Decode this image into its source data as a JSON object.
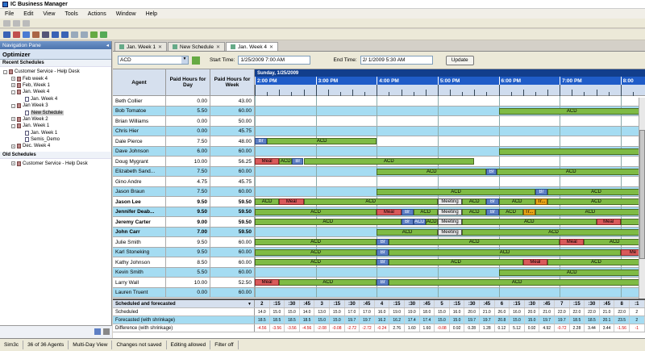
{
  "app": {
    "title": "IC Business Manager"
  },
  "menu": [
    "File",
    "Edit",
    "View",
    "Tools",
    "Actions",
    "Window",
    "Help"
  ],
  "nav": {
    "pane_title": "Navigation Pane",
    "optimizer": "Optimizer",
    "recent_header": "Recent Schedules",
    "recent": [
      {
        "label": "Customer Service - Help Desk",
        "indent": 0,
        "icon": "folder-icon",
        "toggle": "-"
      },
      {
        "label": "Feb week 4",
        "indent": 1,
        "icon": "schedule-icon",
        "toggle": "+"
      },
      {
        "label": "Feb, Week 1",
        "indent": 1,
        "icon": "schedule-icon",
        "toggle": "+"
      },
      {
        "label": "Jan. Week 4",
        "indent": 1,
        "icon": "schedule-icon",
        "toggle": "-"
      },
      {
        "label": "Jan. Week 4",
        "indent": 2,
        "icon": "sheet-icon",
        "toggle": ""
      },
      {
        "label": "Jan Week 3",
        "indent": 1,
        "icon": "schedule-icon",
        "toggle": "-"
      },
      {
        "label": "New Schedule",
        "indent": 2,
        "icon": "sheet-icon",
        "toggle": "",
        "selected": true
      },
      {
        "label": "Jan Week 2",
        "indent": 1,
        "icon": "schedule-icon",
        "toggle": "+"
      },
      {
        "label": "Jan. Week 1",
        "indent": 1,
        "icon": "schedule-icon",
        "toggle": "-"
      },
      {
        "label": "Jan. Week 1",
        "indent": 2,
        "icon": "sheet-icon",
        "toggle": ""
      },
      {
        "label": "Semis_Demo",
        "indent": 2,
        "icon": "sheet-icon",
        "toggle": ""
      },
      {
        "label": "Dec. Week 4",
        "indent": 1,
        "icon": "schedule-icon",
        "toggle": "+"
      }
    ],
    "old_header": "Old Schedules",
    "old": [
      {
        "label": "Customer Service - Help Desk",
        "indent": 1,
        "icon": "folder-icon",
        "toggle": "+"
      }
    ]
  },
  "tabs": [
    {
      "label": "Jan. Week 1",
      "active": false
    },
    {
      "label": "New Schedule",
      "active": false
    },
    {
      "label": "Jan. Week 4",
      "active": true
    }
  ],
  "filters": {
    "queue": "ACD",
    "start_label": "Start Time:",
    "start_value": "1/25/2009  7:00 AM",
    "end_label": "End Time:",
    "end_value": "2/  1/2009  5:30 AM",
    "update": "Update"
  },
  "columns": {
    "agent": "Agent",
    "paid_day": "Paid Hours for Day",
    "paid_week": "Paid Hours for Week"
  },
  "timeline": {
    "date": "Sunday, 1/25/2009",
    "hours": [
      "2:00 PM",
      "3:00 PM",
      "4:00 PM",
      "5:00 PM",
      "6:00 PM",
      "7:00 PM",
      "8:00"
    ]
  },
  "agents": [
    {
      "name": "Beth Collier",
      "day": "0.00",
      "week": "43.00",
      "bold": false,
      "hl": false,
      "segs": []
    },
    {
      "name": "Bob Tomatoe",
      "day": "5.50",
      "week": "60.00",
      "bold": false,
      "hl": true,
      "segs": [
        [
          300,
          480,
          "ACD",
          "ACD"
        ]
      ]
    },
    {
      "name": "Brian Williams",
      "day": "0.00",
      "week": "50.00",
      "bold": false,
      "hl": false,
      "segs": []
    },
    {
      "name": "Chris Hier",
      "day": "0.00",
      "week": "45.75",
      "bold": false,
      "hl": true,
      "segs": []
    },
    {
      "name": "Dale Pierce",
      "day": "7.50",
      "week": "48.00",
      "bold": false,
      "hl": false,
      "segs": [
        [
          0,
          15,
          "Br",
          "Br"
        ],
        [
          15,
          150,
          "ACD",
          "ACD"
        ]
      ]
    },
    {
      "name": "Dave Johnson",
      "day": "6.00",
      "week": "60.00",
      "bold": false,
      "hl": true,
      "segs": [
        [
          300,
          480,
          "ACD",
          ""
        ]
      ]
    },
    {
      "name": "Doug Mygrant",
      "day": "10.00",
      "week": "56.25",
      "bold": false,
      "hl": false,
      "segs": [
        [
          0,
          30,
          "Meal",
          "Meal"
        ],
        [
          30,
          46,
          "ACD",
          "ACD"
        ],
        [
          46,
          60,
          "Br",
          "Br"
        ],
        [
          60,
          270,
          "ACD",
          "ACD"
        ]
      ]
    },
    {
      "name": "Elizabeth Sand...",
      "day": "7.50",
      "week": "60.00",
      "bold": false,
      "hl": true,
      "segs": [
        [
          150,
          285,
          "ACD",
          "ACD"
        ],
        [
          285,
          298,
          "Br",
          "Br"
        ],
        [
          298,
          480,
          "ACD",
          "ACD"
        ]
      ]
    },
    {
      "name": "Gino Andre",
      "day": "4.75",
      "week": "45.75",
      "bold": false,
      "hl": false,
      "segs": []
    },
    {
      "name": "Jason Braun",
      "day": "7.50",
      "week": "60.00",
      "bold": false,
      "hl": true,
      "segs": [
        [
          150,
          345,
          "ACD",
          "ACD"
        ],
        [
          345,
          360,
          "Br",
          "Br"
        ],
        [
          360,
          480,
          "ACD",
          "ACD"
        ]
      ]
    },
    {
      "name": "Jason Lee",
      "day": "9.50",
      "week": "59.50",
      "bold": true,
      "hl": false,
      "segs": [
        [
          0,
          30,
          "ACD",
          "ACD"
        ],
        [
          30,
          60,
          "Meal",
          "Meal"
        ],
        [
          60,
          225,
          "ACD",
          "ACD"
        ],
        [
          225,
          255,
          "Meeting",
          "Meeting"
        ],
        [
          255,
          285,
          "ACD",
          "ACD"
        ],
        [
          285,
          300,
          "Br",
          "Br"
        ],
        [
          300,
          345,
          "ACD",
          "ACD"
        ],
        [
          345,
          360,
          "Tr",
          "Tr..."
        ],
        [
          360,
          480,
          "ACD",
          "ACD"
        ]
      ]
    },
    {
      "name": "Jennifer Deab...",
      "day": "9.50",
      "week": "59.50",
      "bold": true,
      "hl": true,
      "segs": [
        [
          0,
          150,
          "ACD",
          "ACD"
        ],
        [
          150,
          180,
          "Meal",
          "Meal"
        ],
        [
          180,
          195,
          "Br",
          "Br"
        ],
        [
          195,
          225,
          "ACD",
          "ACD"
        ],
        [
          225,
          255,
          "Meeting",
          "Meeting"
        ],
        [
          255,
          285,
          "ACD",
          "ACD"
        ],
        [
          285,
          300,
          "Br",
          "Br"
        ],
        [
          300,
          330,
          "ACD",
          "ACD"
        ],
        [
          330,
          345,
          "Tr",
          "Tr..."
        ],
        [
          345,
          480,
          "ACD",
          "ACD"
        ]
      ]
    },
    {
      "name": "Jeremy Carter",
      "day": "9.00",
      "week": "59.50",
      "bold": true,
      "hl": false,
      "segs": [
        [
          0,
          180,
          "ACD",
          "ACD"
        ],
        [
          180,
          195,
          "Br",
          "Br"
        ],
        [
          195,
          210,
          "Br",
          "ACD"
        ],
        [
          210,
          225,
          "ACD",
          "ACD"
        ],
        [
          225,
          255,
          "Meeting",
          "Meeting"
        ],
        [
          255,
          420,
          "ACD",
          "ACD"
        ],
        [
          420,
          450,
          "Meal",
          "Meal"
        ],
        [
          450,
          480,
          "ACD",
          ""
        ]
      ]
    },
    {
      "name": "John Carr",
      "day": "7.00",
      "week": "59.50",
      "bold": true,
      "hl": true,
      "segs": [
        [
          150,
          225,
          "ACD",
          "ACD"
        ],
        [
          225,
          255,
          "Meeting",
          "Meeting"
        ],
        [
          255,
          480,
          "ACD",
          "ACD"
        ]
      ]
    },
    {
      "name": "Julie Smith",
      "day": "9.50",
      "week": "60.00",
      "bold": false,
      "hl": false,
      "segs": [
        [
          0,
          150,
          "ACD",
          "ACD"
        ],
        [
          150,
          165,
          "Br",
          "Br"
        ],
        [
          165,
          375,
          "ACD",
          "ACD"
        ],
        [
          375,
          405,
          "Meal",
          "Meal"
        ],
        [
          405,
          480,
          "ACD",
          "ACD"
        ]
      ]
    },
    {
      "name": "Karl Stoneking",
      "day": "9.50",
      "week": "60.00",
      "bold": false,
      "hl": true,
      "segs": [
        [
          0,
          150,
          "ACD",
          "ACD"
        ],
        [
          150,
          165,
          "Br",
          "Br"
        ],
        [
          165,
          450,
          "ACD",
          "ACD"
        ],
        [
          450,
          480,
          "Meal",
          "Me"
        ]
      ]
    },
    {
      "name": "Kathy Johnson",
      "day": "8.50",
      "week": "60.00",
      "bold": false,
      "hl": false,
      "segs": [
        [
          0,
          150,
          "ACD",
          "ACD"
        ],
        [
          150,
          165,
          "Br",
          "Br"
        ],
        [
          165,
          330,
          "ACD",
          "ACD"
        ],
        [
          330,
          360,
          "Meal",
          "Meal"
        ],
        [
          360,
          480,
          "ACD",
          "ACD"
        ]
      ]
    },
    {
      "name": "Kevin Smith",
      "day": "5.50",
      "week": "60.00",
      "bold": false,
      "hl": true,
      "segs": [
        [
          300,
          480,
          "ACD",
          "ACD"
        ]
      ]
    },
    {
      "name": "Larry Wall",
      "day": "10.00",
      "week": "52.50",
      "bold": false,
      "hl": false,
      "segs": [
        [
          0,
          30,
          "Meal",
          "Meal"
        ],
        [
          30,
          150,
          "ACD",
          "ACD"
        ],
        [
          150,
          165,
          "Br",
          "Br"
        ],
        [
          165,
          480,
          "ACD",
          "ACD"
        ]
      ]
    },
    {
      "name": "Lauren Truent",
      "day": "0.00",
      "week": "60.00",
      "bold": false,
      "hl": true,
      "segs": []
    }
  ],
  "summary": {
    "dropdown": "Scheduled and forecasted",
    "header": [
      "2",
      ":15",
      ":30",
      ":45",
      "3",
      ":15",
      ":30",
      ":45",
      "4",
      ":15",
      ":30",
      ":45",
      "5",
      ":15",
      ":30",
      ":45",
      "6",
      ":15",
      ":30",
      ":45",
      "7",
      ":15",
      ":30",
      ":45",
      "8",
      ":1"
    ],
    "rows": [
      {
        "label": "Scheduled",
        "values": [
          "14.0",
          "15.0",
          "15.0",
          "14.0",
          "13.0",
          "15.0",
          "17.0",
          "17.0",
          "16.0",
          "19.0",
          "19.0",
          "18.0",
          "15.0",
          "16.0",
          "20.0",
          "21.0",
          "26.0",
          "16.0",
          "20.0",
          "21.0",
          "22.0",
          "22.0",
          "22.0",
          "21.0",
          "22.0",
          "2"
        ],
        "neg": []
      },
      {
        "label": "Forecasted (with shrinkage)",
        "values": [
          "18.5",
          "18.5",
          "18.5",
          "18.5",
          "15.0",
          "15.0",
          "19.7",
          "19.7",
          "16.2",
          "16.2",
          "17.4",
          "17.4",
          "15.0",
          "15.0",
          "19.7",
          "19.7",
          "20.8",
          "15.0",
          "15.0",
          "19.7",
          "19.7",
          "18.5",
          "18.5",
          "20.1",
          "23.5",
          "2"
        ],
        "neg": []
      },
      {
        "label": "Difference (with shrinkage)",
        "values": [
          "-4.56",
          "-3.56",
          "-3.56",
          "-4.56",
          "-2.08",
          "-0.08",
          "-2.72",
          "-2.72",
          "-0.24",
          "2.76",
          "1.60",
          "1.60",
          "-0.08",
          "0.92",
          "0.28",
          "1.28",
          "0.12",
          "5.12",
          "0.92",
          "4.92",
          "-0.72",
          "2.28",
          "3.44",
          "3.44",
          "-1.56",
          "-1"
        ],
        "neg": [
          0,
          1,
          2,
          3,
          4,
          5,
          6,
          7,
          8,
          12,
          20,
          24,
          25
        ]
      }
    ]
  },
  "status": [
    "Sim3c",
    "36 of 36 Agents",
    "Multi-Day View",
    "Changes not saved",
    "Editing allowed",
    "Filter off"
  ],
  "colors": {
    "acd": "#7fbb45",
    "meal": "#d95a5a",
    "break": "#5d7fc4",
    "meeting": "#e8e8e8",
    "training": "#e5a316",
    "row_highlight": "#a5dcf2",
    "hour_bar": "#1f5cc8"
  }
}
